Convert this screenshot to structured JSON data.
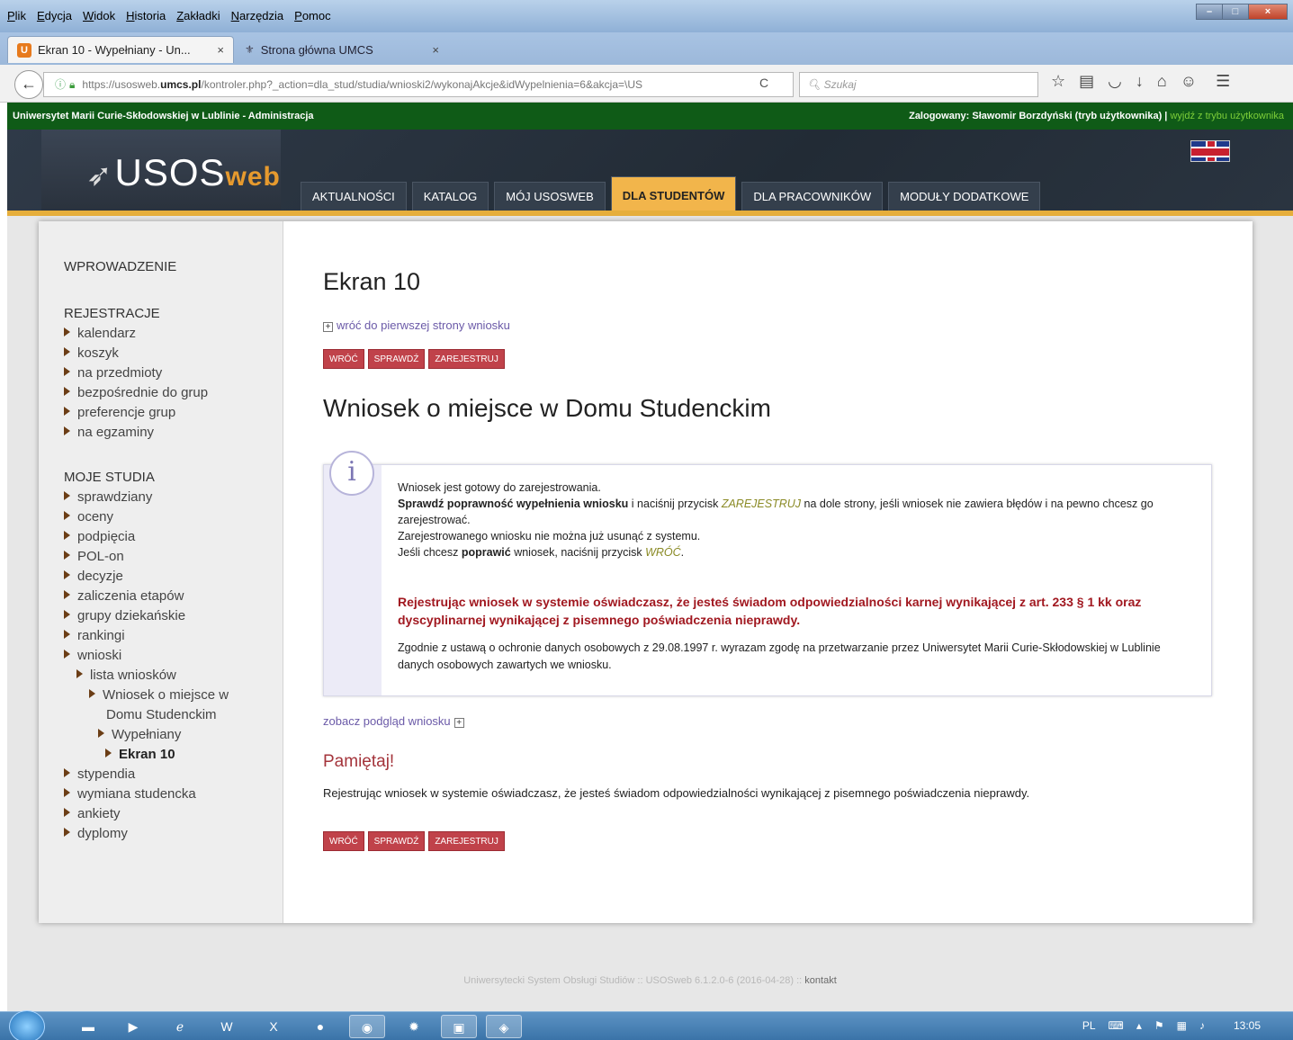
{
  "browser": {
    "menu": [
      "Plik",
      "Edycja",
      "Widok",
      "Historia",
      "Zakładki",
      "Narzędzia",
      "Pomoc"
    ],
    "tabs": [
      {
        "label": "Ekran 10 - Wypełniany - Un...",
        "close": "×"
      },
      {
        "label": "Strona główna UMCS",
        "close": "×"
      }
    ],
    "new_tab": "+",
    "url_prefix": "https://usosweb.",
    "url_domain": "umcs.pl",
    "url_rest": "/kontroler.php?_action=dla_stud/studia/wnioski2/wykonajAkcje&idWypelnienia=6&akcja=\\US",
    "search_placeholder": "Szukaj"
  },
  "usos": {
    "univ_name": "Uniwersytet Marii Curie-Skłodowskiej w Lublinie - Administracja",
    "logged_in": "Zalogowany: Sławomir Borzdyński (tryb użytkownika) |",
    "exit_link": "wyjdź z trybu użytkownika",
    "logo_main": "USOS",
    "logo_web": "web",
    "nav_tabs": [
      "AKTUALNOŚCI",
      "KATALOG",
      "MÓJ USOSWEB",
      "DLA STUDENTÓW",
      "DLA PRACOWNIKÓW",
      "MODUŁY DODATKOWE"
    ]
  },
  "sidebar": {
    "intro": "WPROWADZENIE",
    "reg_title": "REJESTRACJE",
    "reg_items": [
      "kalendarz",
      "koszyk",
      "na przedmioty",
      "bezpośrednie do grup",
      "preferencje grup",
      "na egzaminy"
    ],
    "studies_title": "MOJE STUDIA",
    "studies_items": [
      "sprawdziany",
      "oceny",
      "podpięcia",
      "POL-on",
      "decyzje",
      "zaliczenia etapów",
      "grupy dziekańskie",
      "rankingi",
      "wnioski"
    ],
    "wnioski_sub": {
      "lista": "lista wniosków",
      "wniosek_line1": "Wniosek o miejsce w",
      "wniosek_line2": "Domu Studenckim",
      "wypelniany": "Wypełniany",
      "ekran": "Ekran 10"
    },
    "more_items": [
      "stypendia",
      "wymiana studencka",
      "ankiety",
      "dyplomy"
    ]
  },
  "main": {
    "title": "Ekran 10",
    "back_link": "wróć do pierwszej strony wniosku",
    "buttons": [
      "WRÓĆ",
      "SPRAWDŹ",
      "ZAREJESTRUJ"
    ],
    "subtitle": "Wniosek o miejsce w Domu Studenckim",
    "info": {
      "line1": "Wniosek jest gotowy do zarejestrowania.",
      "check_bold": "Sprawdź poprawność wypełnienia wniosku",
      "check_rest1": " i naciśnij przycisk ",
      "check_em": "ZAREJESTRUJ",
      "check_rest2": " na dole strony, jeśli wniosek nie zawiera błędów i na pewno chcesz go zarejestrować.",
      "line3": "Zarejestrowanego wniosku nie można już usunąć z systemu.",
      "fix_pre": "Jeśli chcesz ",
      "fix_bold": "poprawić",
      "fix_mid": " wniosek, naciśnij przycisk ",
      "fix_em": "WRÓĆ",
      "fix_post": ".",
      "warning": "Rejestrując wniosek w systemie oświadczasz, że jesteś świadom odpowiedzialności karnej wynikającej z art. 233 § 1 kk oraz dyscyplinarnej wynikającej z pisemnego poświadczenia nieprawdy.",
      "consent": "Zgodnie z ustawą o ochronie danych osobowych z 29.08.1997 r. wyrazam zgodę na przetwarzanie przez Uniwersytet Marii Curie-Skłodowskiej w Lublinie danych osobowych zawartych we wniosku."
    },
    "preview_link": "zobacz podgląd wniosku",
    "remember_title": "Pamiętaj!",
    "remember_text": "Rejestrując wniosek w systemie oświadczasz, że jesteś świadom odpowiedzialności wynikającej z pisemnego poświadczenia nieprawdy."
  },
  "footer": {
    "text": "Uniwersytecki System Obsługi Studiów :: USOSweb 6.1.2.0-6 (2016-04-28) ::",
    "kontakt": "kontakt"
  },
  "taskbar": {
    "lang": "PL",
    "time": "13:05"
  }
}
